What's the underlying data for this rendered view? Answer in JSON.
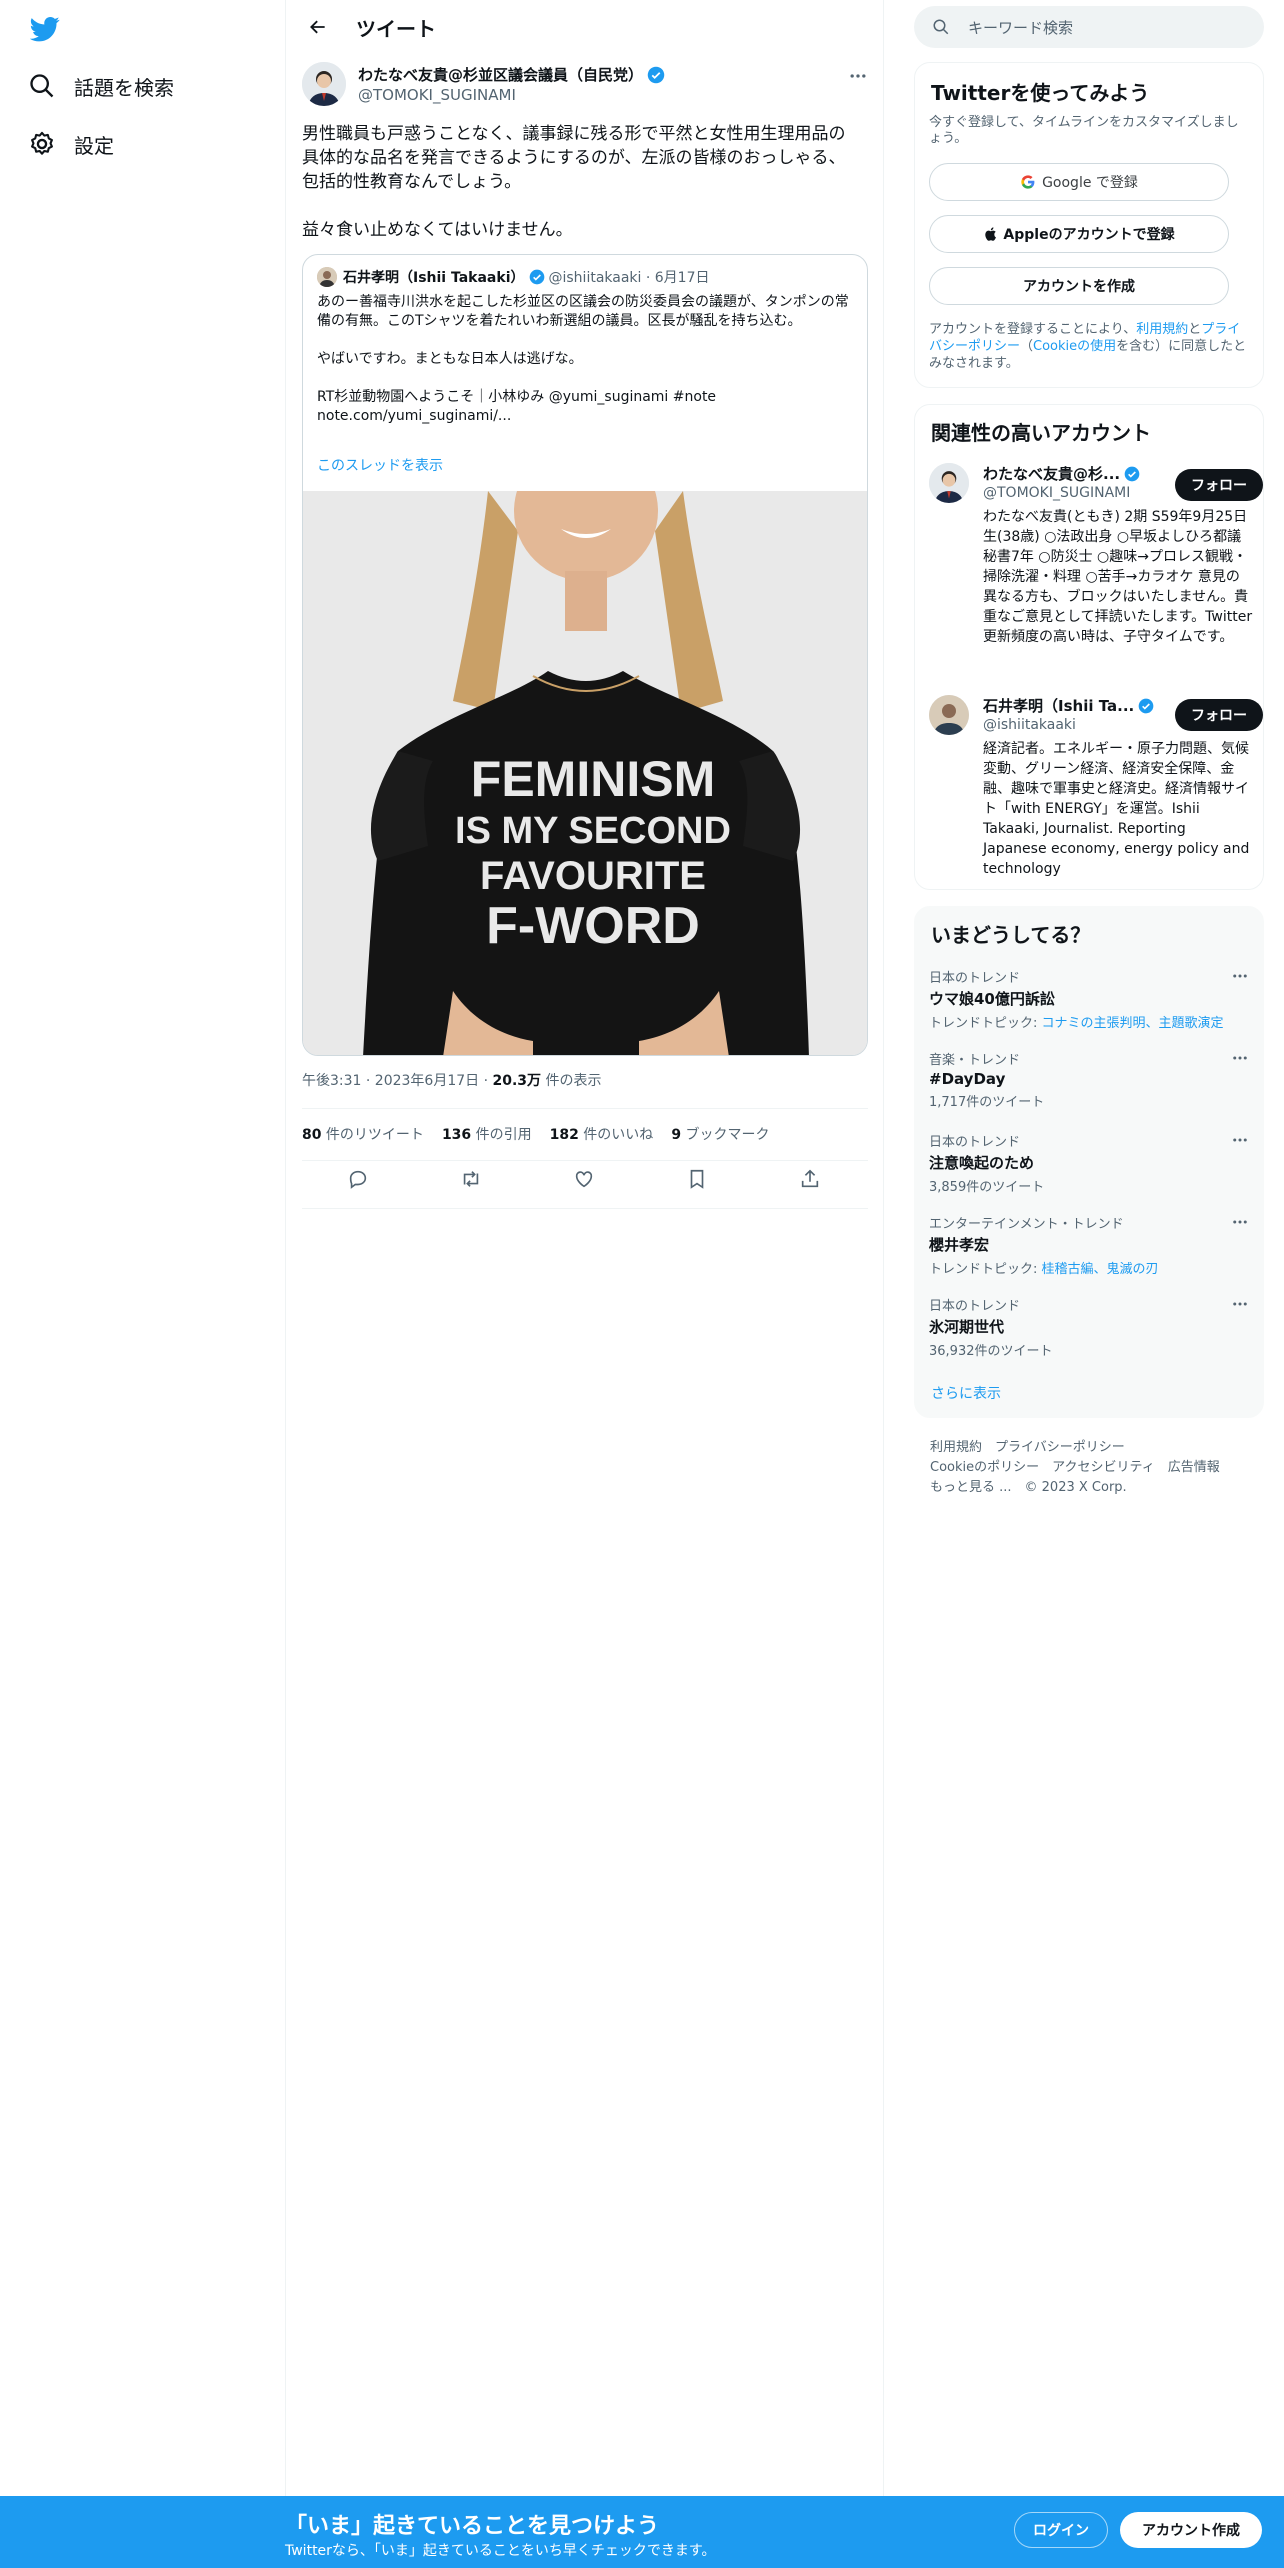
{
  "nav": {
    "explore_label": "話題を検索",
    "settings_label": "設定"
  },
  "header": {
    "title": "ツイート"
  },
  "tweet": {
    "author_name": "わたなべ友貴@杉並区議会議員（自民党）",
    "author_handle": "@TOMOKI_SUGINAMI",
    "text": "男性職員も戸惑うことなく、議事録に残る形で平然と女性用生理用品の具体的な品名を発言できるようにするのが、左派の皆様のおっしゃる、包括的性教育なんでしょう。\n\n益々食い止めなくてはいけません。",
    "quote": {
      "author_name": "石井孝明（Ishii Takaaki）",
      "author_meta": "@ishiitakaaki · 6月17日",
      "text": "あのー善福寺川洪水を起こした杉並区の区議会の防災委員会の議題が、タンポンの常備の有無。このTシャツを着たれいわ新選組の議員。区長が騒乱を持ち込む。\n\nやばいですわ。まともな日本人は逃げな。\n\nRT杉並動物園へようこそ｜小林ゆみ @yumi_suginami #note\nnote.com/yumi_suginami/...",
      "thread_link": "このスレッドを表示",
      "shirt_text": [
        "FEMINISM",
        "IS MY SECOND",
        "FAVOURITE",
        "F-WORD"
      ]
    },
    "time": "午後3:31 · 2023年6月17日 · ",
    "views_count": "20.3万",
    "views_label": " 件の表示",
    "stats": [
      {
        "count": "80",
        "label": " 件のリツイート"
      },
      {
        "count": "136",
        "label": " 件の引用"
      },
      {
        "count": "182",
        "label": " 件のいいね"
      },
      {
        "count": "9",
        "label": " ブックマーク"
      }
    ]
  },
  "sidebar": {
    "search_placeholder": "キーワード検索",
    "signup": {
      "title": "Twitterを使ってみよう",
      "subtitle": "今すぐ登録して、タイムラインをカスタマイズしましょう。",
      "google_label": "Google で登録",
      "apple_label": "Appleのアカウントで登録",
      "create_label": "アカウントを作成",
      "legal_1": "アカウントを登録することにより、",
      "legal_link1": "利用規約",
      "legal_2": "と",
      "legal_link2": "プライバシーポリシー",
      "legal_3": "（",
      "legal_link3": "Cookieの使用",
      "legal_4": "を含む）に同意したとみなされます。"
    },
    "related": {
      "title": "関連性の高いアカウント",
      "follow_label": "フォロー",
      "accounts": [
        {
          "name": "わたなべ友貴@杉...",
          "handle": "@TOMOKI_SUGINAMI",
          "bio": "わたなべ友貴(ともき) 2期 S59年9月25日生(38歳) ○法政出身 ○早坂よしひろ都議秘書7年 ○防災士 ○趣味→プロレス観戦・掃除洗濯・料理 ○苦手→カラオケ 意見の異なる方も、ブロックはいたしません。貴重なご意見として拝読いたします。Twitter更新頻度の高い時は、子守タイムです。"
        },
        {
          "name": "石井孝明（Ishii Ta...",
          "handle": "@ishiitakaaki",
          "bio": "経済記者。エネルギー・原子力問題、気候変動、グリーン経済、経済安全保障、金融、趣味で軍事史と経済史。経済情報サイト「with ENERGY」を運営。Ishii Takaaki, Journalist. Reporting Japanese economy, energy policy and technology"
        }
      ]
    },
    "trends": {
      "title": "いまどうしてる？",
      "items": [
        {
          "category": "日本のトレンド",
          "name": "ウマ娘40億円訴訟",
          "sub_prefix": "トレンドトピック: ",
          "sub_link": "コナミの主張判明、主題歌演定"
        },
        {
          "category": "音楽・トレンド",
          "name": "#DayDay",
          "sub_prefix": "1,717件のツイート",
          "sub_link": ""
        },
        {
          "category": "日本のトレンド",
          "name": "注意喚起のため",
          "sub_prefix": "3,859件のツイート",
          "sub_link": ""
        },
        {
          "category": "エンターテインメント・トレンド",
          "name": "櫻井孝宏",
          "sub_prefix": "トレンドトピック: ",
          "sub_link": "桂稽古編、鬼滅の刃"
        },
        {
          "category": "日本のトレンド",
          "name": "氷河期世代",
          "sub_prefix": "36,932件のツイート",
          "sub_link": ""
        }
      ],
      "show_more": "さらに表示"
    },
    "footer": {
      "line1": "利用規約　プライバシーポリシー",
      "line2": "Cookieのポリシー　アクセシビリティ　広告情報",
      "line3": "もっと見る ...　© 2023 X Corp."
    }
  },
  "bottom_bar": {
    "title": "「いま」起きていることを見つけよう",
    "subtitle": "Twitterなら、「いま」起きていることをいち早くチェックできます。",
    "login_label": "ログイン",
    "signup_label": "アカウント作成"
  },
  "colors": {
    "accent": "#1d9bf0",
    "text": "#0f1419",
    "muted": "#536471"
  }
}
